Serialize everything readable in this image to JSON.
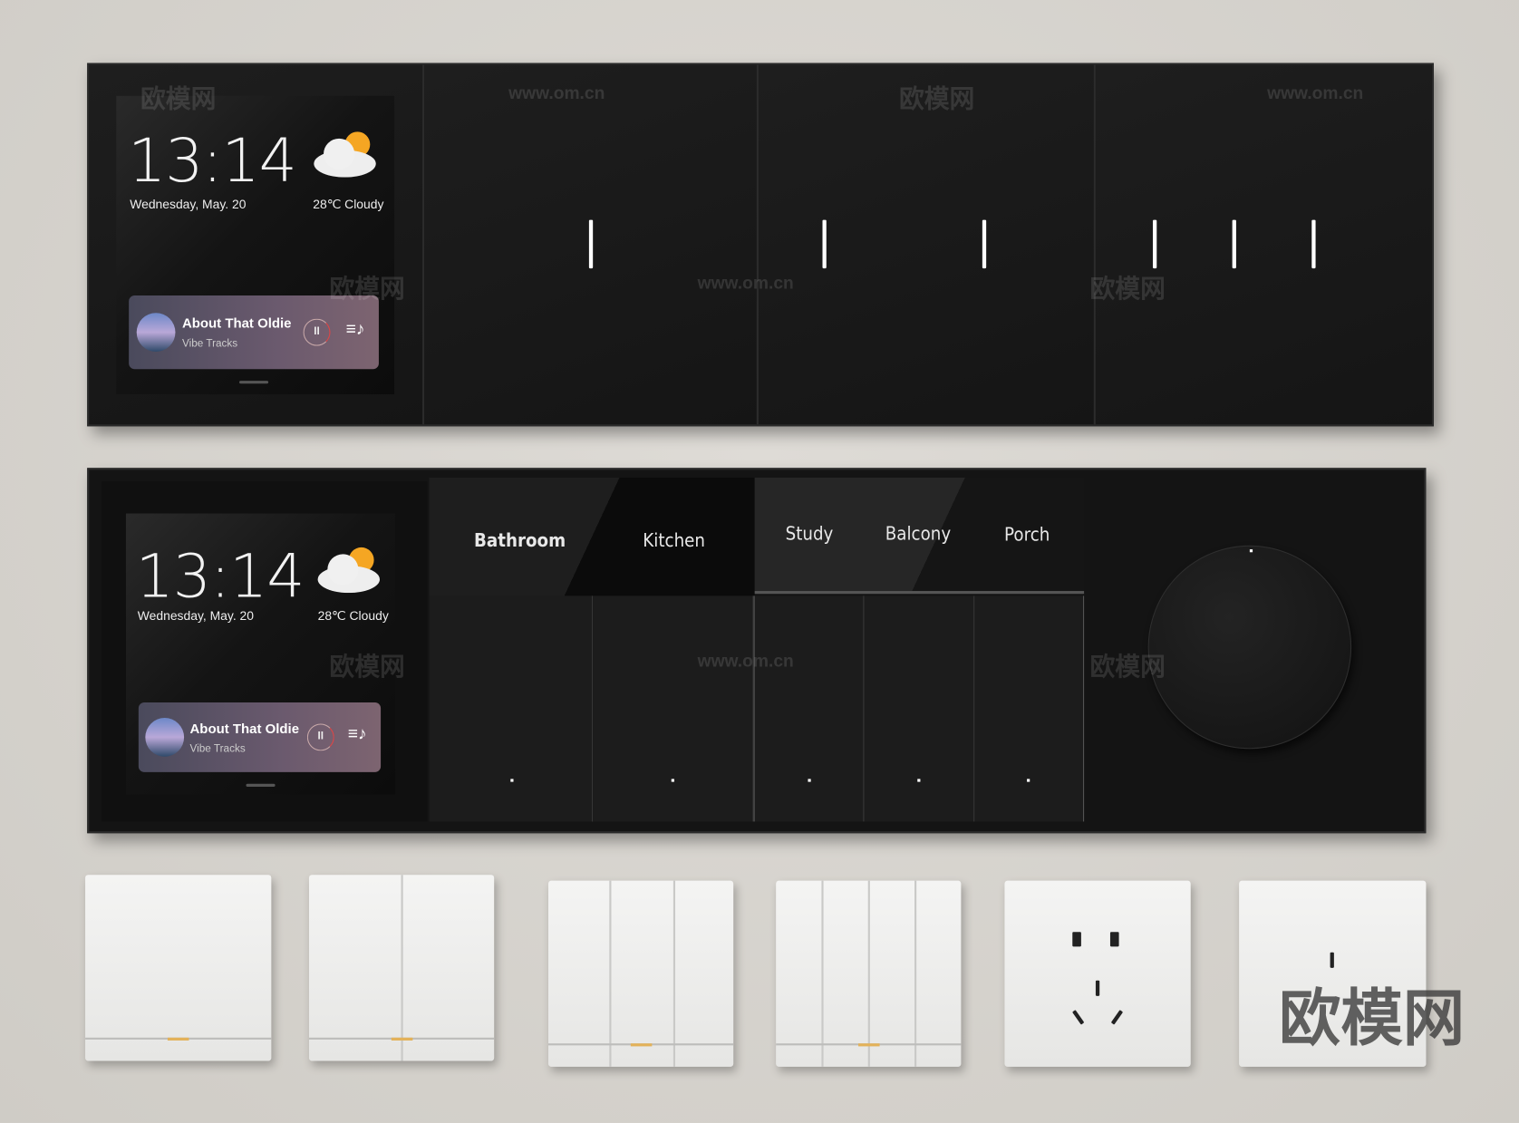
{
  "panel_top": {
    "screen": {
      "time": "13:14",
      "date": "Wednesday, May. 20",
      "weather": "28℃  Cloudy",
      "weather_icon": "cloud-sun-icon",
      "music": {
        "title": "About That Oldie",
        "artist": "Vibe Tracks",
        "pause_icon": "pause-icon",
        "playlist_icon": "playlist-icon"
      }
    },
    "switch_gangs": [
      1,
      2,
      3
    ]
  },
  "panel_bottom": {
    "screen": {
      "time": "13:14",
      "date": "Wednesday, May. 20",
      "weather": "28℃  Cloudy",
      "weather_icon": "cloud-sun-icon",
      "music": {
        "title": "About That Oldie",
        "artist": "Vibe Tracks",
        "pause_icon": "pause-icon",
        "playlist_icon": "playlist-icon"
      }
    },
    "labels": [
      "Bathroom",
      "Kitchen",
      "Study",
      "Balcony",
      "Porch"
    ],
    "knob": "rotary-dimmer-knob"
  },
  "white_switches": [
    "1-gang switch",
    "2-gang switch",
    "3-gang switch",
    "4-gang switch",
    "5-pin socket",
    "3-pin socket"
  ],
  "colors": {
    "panel": "#141414",
    "indicator": "#ffffff",
    "led": "#e3b25a",
    "wall": "#d6d3ce"
  },
  "watermark": {
    "cn": "欧模网",
    "url": "www.om.cn"
  }
}
